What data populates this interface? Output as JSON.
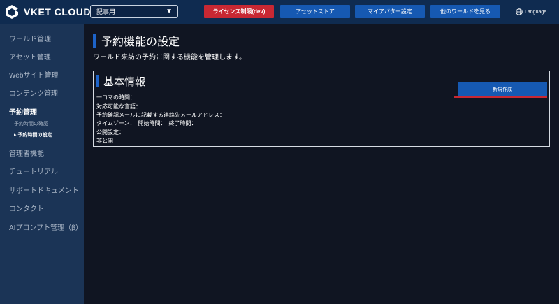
{
  "header": {
    "logo_text": "VKET CLOUD",
    "world_select": "記事用",
    "buttons": {
      "license": "ライセンス制限(dev)",
      "asset_store": "アセットストア",
      "my_avatar": "マイアバター設定",
      "other_worlds": "他のワールドを見る"
    },
    "language": "Language",
    "colors": {
      "header_bg": "#0f2b50",
      "red": "#c82833",
      "blue": "#1659b2"
    }
  },
  "sidebar": {
    "items": [
      {
        "label": "ワールド管理"
      },
      {
        "label": "アセット管理"
      },
      {
        "label": "Webサイト管理"
      },
      {
        "label": "コンテンツ管理"
      },
      {
        "label": "予約管理"
      },
      {
        "label": "管理者機能"
      },
      {
        "label": "チュートリアル"
      },
      {
        "label": "サポートドキュメント"
      },
      {
        "label": "コンタクト"
      },
      {
        "label": "AIプロンプト管理（β）"
      }
    ],
    "sub_items": [
      {
        "label": "予約時間の確認"
      },
      {
        "label": "▸ 予約時間の設定"
      }
    ]
  },
  "main": {
    "title": "予約機能の設定",
    "description": "ワールド来訪の予約に関する機能を管理します。",
    "panel": {
      "title": "基本情報",
      "create_button": "新規作成",
      "fields": [
        "一コマの時間：",
        "対応可能な言語：",
        "予約確認メールに記載する連絡先メールアドレス：",
        "タイムゾーン：　開始時間：　終了時間：",
        "公開設定：",
        "非公開"
      ]
    }
  }
}
